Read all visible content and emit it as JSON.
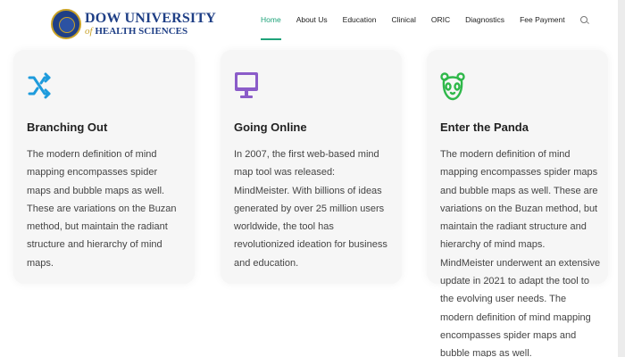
{
  "header": {
    "logo_line1": "DOW UNIVERSITY",
    "logo_of": "of",
    "logo_line2": "HEALTH SCIENCES",
    "nav": [
      "Home",
      "About Us",
      "Education",
      "Clinical",
      "ORIC",
      "Diagnostics",
      "Fee Payment"
    ],
    "active_nav": "Home",
    "accent_color": "#1fa37a"
  },
  "cards": [
    {
      "icon": "shuffle-arrows-icon",
      "icon_color": "#1e9bdc",
      "title": "Branching Out",
      "body": "The modern definition of mind mapping encompasses spider maps and bubble maps as well. These are variations on the Buzan method, but maintain the radiant structure and hierarchy of mind maps."
    },
    {
      "icon": "monitor-icon",
      "icon_color": "#8b5cc9",
      "title": "Going Online",
      "body": "In 2007, the first web-based mind map tool was released: MindMeister. With billions of ideas generated by over 25 million users worldwide, the tool has revolutionized ideation for business and education."
    },
    {
      "icon": "panda-icon",
      "icon_color": "#2fb84a",
      "title": "Enter the Panda",
      "body": "The modern definition of mind mapping encompasses spider maps and bubble maps as well. These are variations on the Buzan method, but maintain the radiant structure and hierarchy of mind maps. MindMeister underwent an extensive update in 2021 to adapt the tool to the evolving user needs. The modern definition of mind mapping encompasses spider maps and bubble maps as well."
    }
  ]
}
